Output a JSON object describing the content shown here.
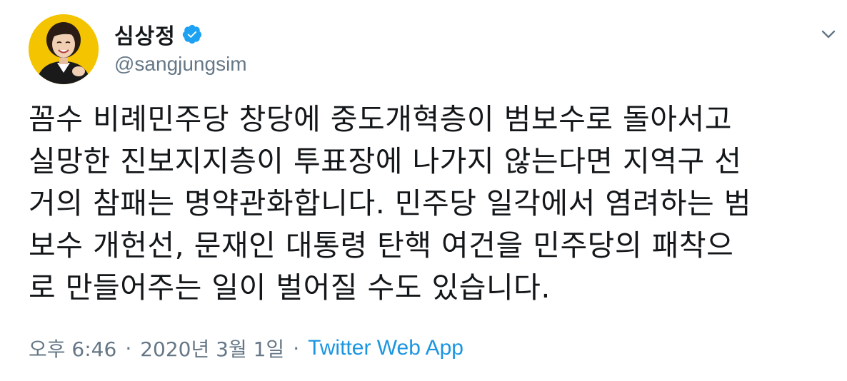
{
  "author": {
    "display_name": "심상정",
    "handle": "@sangjungsim",
    "verified": true,
    "avatar_icon": "profile-photo",
    "avatar_bg_color": "#f5c400"
  },
  "tweet": {
    "text": "꼼수 비례민주당 창당에 중도개혁층이 범보수로 돌아서고\n실망한 진보지지층이 투표장에 나가지 않는다면 지역구 선\n거의 참패는 명약관화합니다. 민주당 일각에서 염려하는 범\n보수 개헌선, 문재인 대통령 탄핵 여건을 민주당의 패착으\n로 만들어주는 일이 벌어질 수도 있습니다."
  },
  "meta": {
    "time": "오후 6:46",
    "separator": "·",
    "date": "2020년 3월 1일",
    "source": "Twitter Web App",
    "source_color": "#1b95e0"
  },
  "icons": {
    "verified": "verified-badge-icon",
    "menu": "chevron-down-icon"
  }
}
